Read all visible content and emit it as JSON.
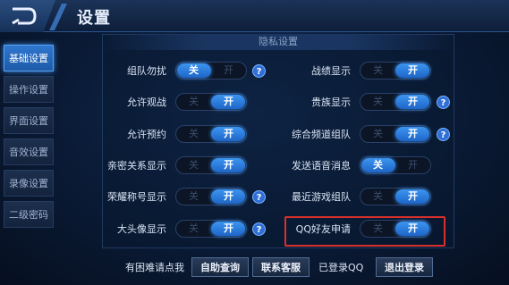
{
  "header": {
    "title": "设置"
  },
  "sidebar": {
    "items": [
      {
        "label": "基础设置",
        "active": true
      },
      {
        "label": "操作设置",
        "active": false
      },
      {
        "label": "界面设置",
        "active": false
      },
      {
        "label": "音效设置",
        "active": false
      },
      {
        "label": "录像设置",
        "active": false
      },
      {
        "label": "二级密码",
        "active": false
      }
    ]
  },
  "panel": {
    "title": "隐私设置"
  },
  "toggle_text": {
    "off": "关",
    "on": "开"
  },
  "help_text": "?",
  "settings": [
    {
      "label": "组队勿扰",
      "state": "off",
      "help": true
    },
    {
      "label": "允许观战",
      "state": "on",
      "help": false
    },
    {
      "label": "允许预约",
      "state": "on",
      "help": false
    },
    {
      "label": "亲密关系显示",
      "state": "on",
      "help": false
    },
    {
      "label": "荣耀称号显示",
      "state": "on",
      "help": true
    },
    {
      "label": "大头像显示",
      "state": "on",
      "help": true
    },
    {
      "label": "战绩显示",
      "state": "on",
      "help": false
    },
    {
      "label": "贵族显示",
      "state": "on",
      "help": true
    },
    {
      "label": "综合频道组队",
      "state": "on",
      "help": true
    },
    {
      "label": "发送语音消息",
      "state": "off",
      "help": false
    },
    {
      "label": "最近游戏组队",
      "state": "on",
      "help": false
    },
    {
      "label": "QQ好友申请",
      "state": "on",
      "help": false
    }
  ],
  "footer": {
    "help_text": "有困难请点我",
    "self_service_button": "自助查询",
    "contact_button": "联系客服",
    "login_status": "已登录QQ",
    "logout_button": "退出登录"
  },
  "colors": {
    "accent": "#2f7be0",
    "highlight": "#d9302c"
  }
}
